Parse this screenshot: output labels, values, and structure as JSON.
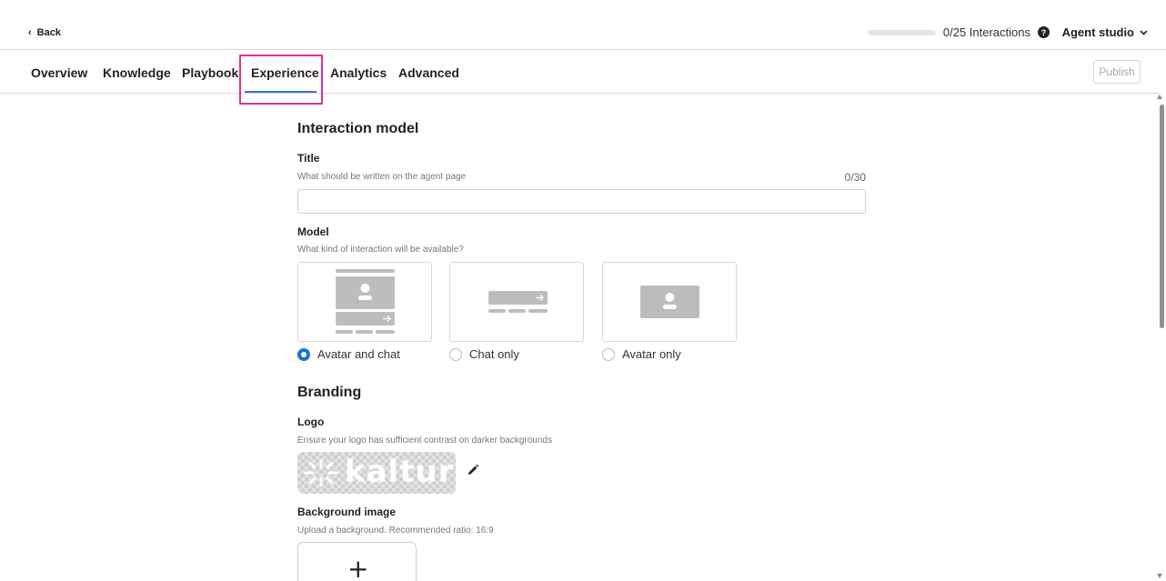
{
  "header": {
    "back_label": "Back",
    "interactions_text": "0/25 Interactions",
    "interactions_progress": 0,
    "studio_label": "Agent studio"
  },
  "tabs": [
    {
      "label": "Overview"
    },
    {
      "label": "Knowledge"
    },
    {
      "label": "Playbook"
    },
    {
      "label": "Experience",
      "active": true
    },
    {
      "label": "Analytics"
    },
    {
      "label": "Advanced"
    }
  ],
  "publish_label": "Publish",
  "interaction_model": {
    "heading": "Interaction model",
    "title_label": "Title",
    "title_hint": "What should be written on the agent page",
    "title_counter": "0/30",
    "title_value": "",
    "model_label": "Model",
    "model_hint": "What kind of interaction will be available?",
    "options": [
      {
        "label": "Avatar and chat",
        "selected": true
      },
      {
        "label": "Chat only",
        "selected": false
      },
      {
        "label": "Avatar only",
        "selected": false
      }
    ]
  },
  "branding": {
    "heading": "Branding",
    "logo_label": "Logo",
    "logo_hint": "Ensure your logo has sufficient contrast on darker backgrounds",
    "logo_text": "kaltura",
    "background_label": "Background image",
    "background_hint": "Upload a background. Recommended ratio: 16:9"
  },
  "colors": {
    "accent": "#1a73d9",
    "tab_underline": "#2f78d6",
    "highlight": "#e0338a"
  },
  "icons": [
    "back-chevron-icon",
    "help-icon",
    "chevron-down-icon",
    "pencil-icon",
    "plus-icon"
  ]
}
